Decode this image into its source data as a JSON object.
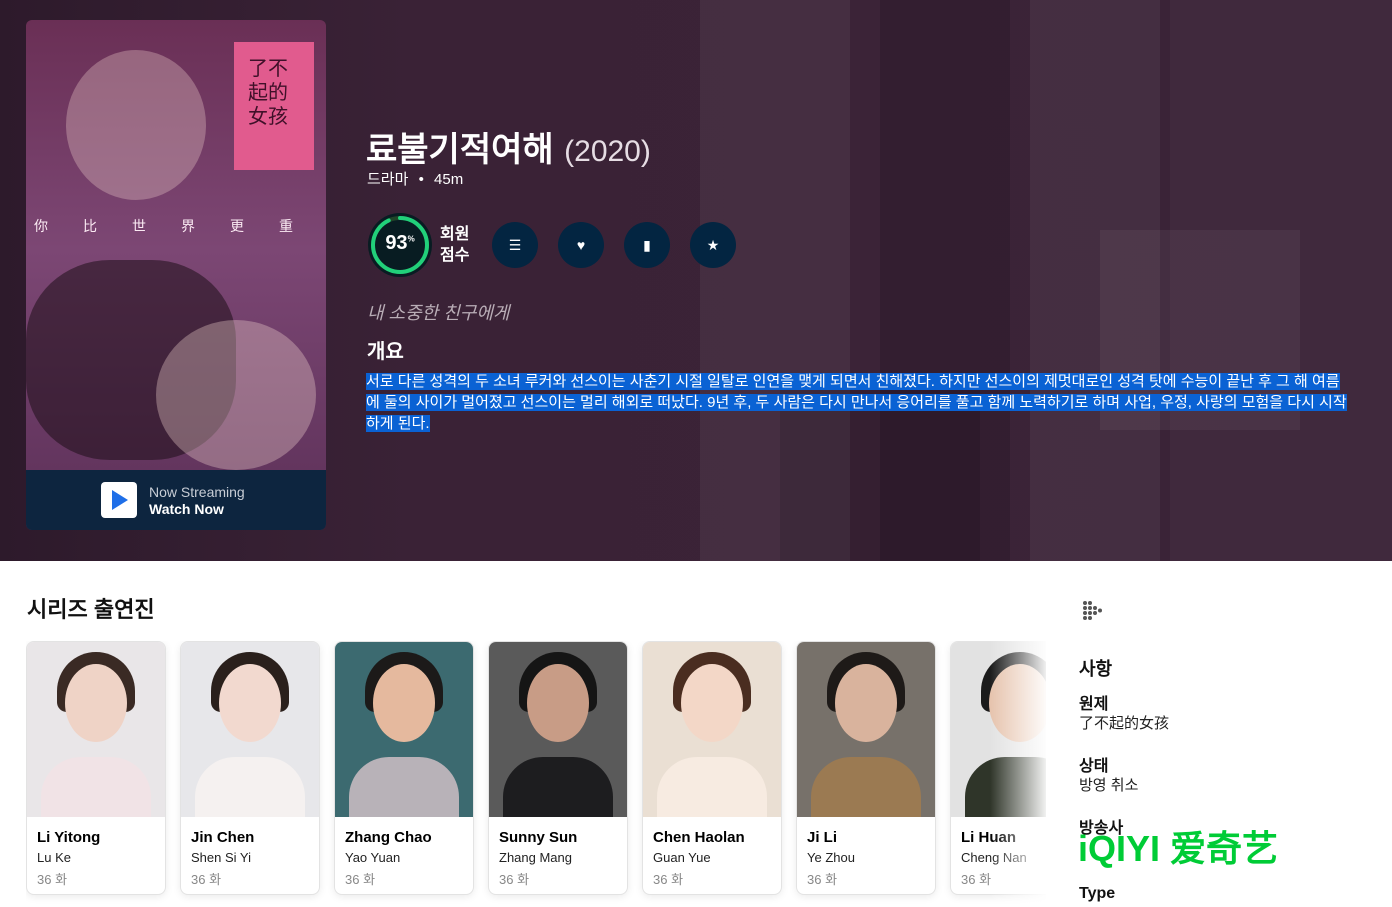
{
  "hero": {
    "poster": {
      "chars": "了不起的女孩",
      "tagline_cn": "你比世界更重",
      "stream_line1": "Now Streaming",
      "stream_line2": "Watch Now"
    },
    "title": "료불기적여해",
    "year": "(2020)",
    "genre": "드라마",
    "separator": "•",
    "runtime": "45m",
    "score": {
      "value": "93",
      "unit": "%",
      "percent": 93,
      "label": "회원 점수",
      "ring_color": "#21d07a",
      "track_color": "#204529"
    },
    "tagline": "내 소중한 친구에게",
    "overview_heading": "개요",
    "overview": "서로 다른 성격의 두 소녀 루커와 선스이는 사춘기 시절 일탈로 인연을 맺게 되면서 친해졌다. 하지만 선스이의 제멋대로인 성격 탓에 수능이 끝난 후 그 해 여름에 둘의 사이가 멀어졌고 선스이는 멀리 해외로 떠났다. 9년 후, 두 사람은 다시 만나서 응어리를 풀고 함께 노력하기로 하며 사업, 우정, 사랑의 모험을 다시 시작하게 된다."
  },
  "actions": [
    {
      "icon": "list-icon",
      "glyph": "☰"
    },
    {
      "icon": "heart-icon",
      "glyph": "♥"
    },
    {
      "icon": "bookmark-icon",
      "glyph": "▮"
    },
    {
      "icon": "star-icon",
      "glyph": "★"
    }
  ],
  "cast_section": {
    "heading": "시리즈 출연진",
    "members": [
      {
        "name": "Li Yitong",
        "character": "Lu Ke",
        "episodes": "36 화"
      },
      {
        "name": "Jin Chen",
        "character": "Shen Si Yi",
        "episodes": "36 화"
      },
      {
        "name": "Zhang Chao",
        "character": "Yao Yuan",
        "episodes": "36 화"
      },
      {
        "name": "Sunny Sun",
        "character": "Zhang Mang",
        "episodes": "36 화"
      },
      {
        "name": "Chen Haolan",
        "character": "Guan Yue",
        "episodes": "36 화"
      },
      {
        "name": "Ji Li",
        "character": "Ye Zhou",
        "episodes": "36 화"
      },
      {
        "name": "Li Huan",
        "character": "Cheng Nan",
        "episodes": "36 화"
      }
    ]
  },
  "facts": {
    "heading": "사항",
    "original_title_label": "원제",
    "original_title": "了不起的女孩",
    "status_label": "상태",
    "status": "방영 취소",
    "network_label": "방송사",
    "network_logo": "iQIYI 爱奇艺",
    "type_label": "Type"
  },
  "colors": {
    "overview_highlight": "#0a62d4",
    "action_bg": "#032541",
    "stream_bar": "#0d253f",
    "iqiyi_green": "#00cc36"
  }
}
